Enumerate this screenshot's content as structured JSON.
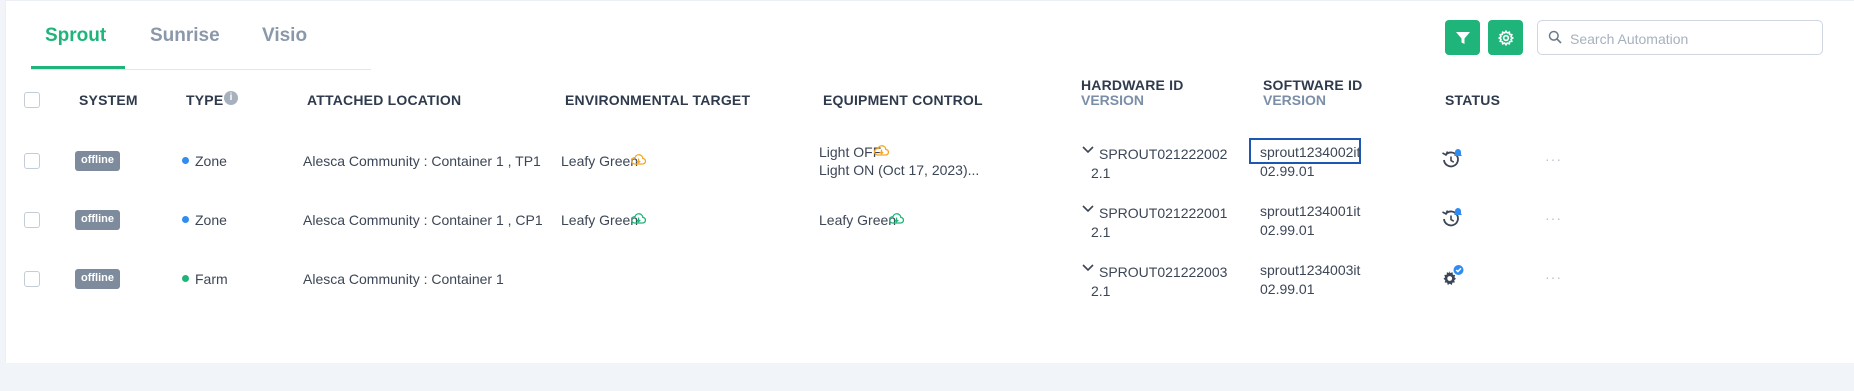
{
  "tabs": [
    {
      "label": "Sprout",
      "active": true
    },
    {
      "label": "Sunrise",
      "active": false
    },
    {
      "label": "Visio",
      "active": false
    }
  ],
  "toolbar": {
    "filter_icon": "filter-icon",
    "settings_icon": "gear-icon",
    "search_placeholder": "Search Automation",
    "search_value": ""
  },
  "colors": {
    "accent": "#1fb47a",
    "zone_dot": "#2f8cf0",
    "farm_dot": "#1fb47a",
    "badge": "#7d8b9c",
    "highlight": "#1c58b0",
    "alert_orange": "#f5a623",
    "alert_green": "#1fb47a"
  },
  "headers": {
    "system": "SYSTEM",
    "type": "TYPE",
    "location": "ATTACHED LOCATION",
    "env_target": "ENVIRONMENTAL TARGET",
    "equipment": "EQUIPMENT CONTROL",
    "hardware_id": "HARDWARE ID",
    "hardware_version": "VERSION",
    "software_id": "SOFTWARE ID",
    "software_version": "VERSION",
    "status": "STATUS"
  },
  "rows": [
    {
      "system": "offline",
      "type": "Zone",
      "location": "Alesca Community : Container 1 , TP1",
      "env_target": "Leafy Green",
      "env_icon": "cloud-download-icon",
      "equipment_line1": "Light OFF",
      "equipment_line2": "Light ON (Oct 17, 2023)...",
      "hardware_id": "SPROUT021222002",
      "hardware_version": "2.1",
      "software_id": "sprout1234002it",
      "software_version": "02.99.01",
      "status_icon": "history-icon"
    },
    {
      "system": "offline",
      "type": "Zone",
      "location": "Alesca Community : Container 1 , CP1",
      "env_target": "Leafy Green",
      "env_icon": "cloud-download-icon",
      "equipment_line1": "Leafy Green",
      "equipment_line2": "",
      "hardware_id": "SPROUT021222001",
      "hardware_version": "2.1",
      "software_id": "sprout1234001it",
      "software_version": "02.99.01",
      "status_icon": "history-icon"
    },
    {
      "system": "offline",
      "type": "Farm",
      "location": "Alesca Community : Container 1",
      "env_target": "",
      "env_icon": "",
      "equipment_line1": "",
      "equipment_line2": "",
      "hardware_id": "SPROUT021222003",
      "hardware_version": "2.1",
      "software_id": "sprout1234003it",
      "software_version": "02.99.01",
      "status_icon": "gear-icon"
    }
  ],
  "row_actions": "···"
}
